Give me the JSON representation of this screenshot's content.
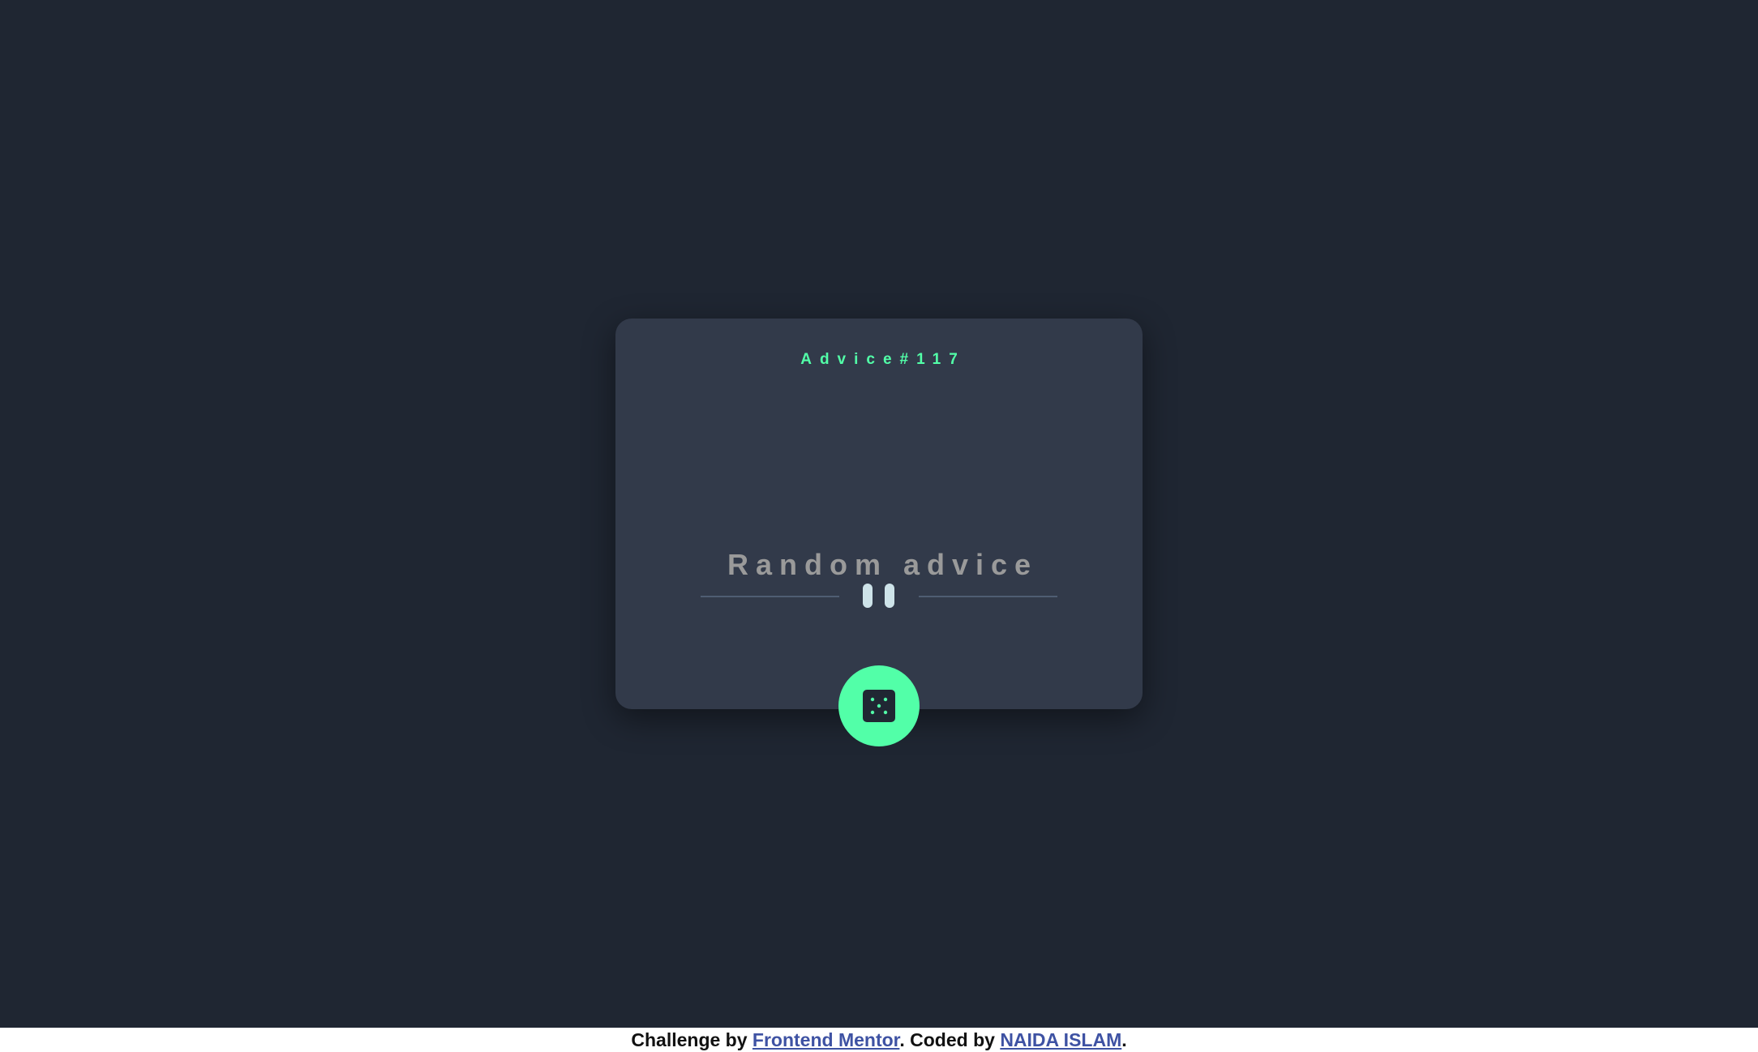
{
  "card": {
    "advice_number": "Advice#117",
    "advice_text": "Random advice"
  },
  "dice_button": {
    "icon": "dice-icon"
  },
  "footer": {
    "challenge_prefix": "Challenge by ",
    "challenge_link": "Frontend Mentor",
    "coded_prefix": ". Coded by ",
    "author_link": "NAIDA ISLAM",
    "suffix": "."
  },
  "colors": {
    "background": "#1f2632",
    "card": "#323a4a",
    "accent": "#52ffa8",
    "divider": "#4f5d73",
    "pause": "#cee3e9",
    "link": "#3e52a3"
  }
}
